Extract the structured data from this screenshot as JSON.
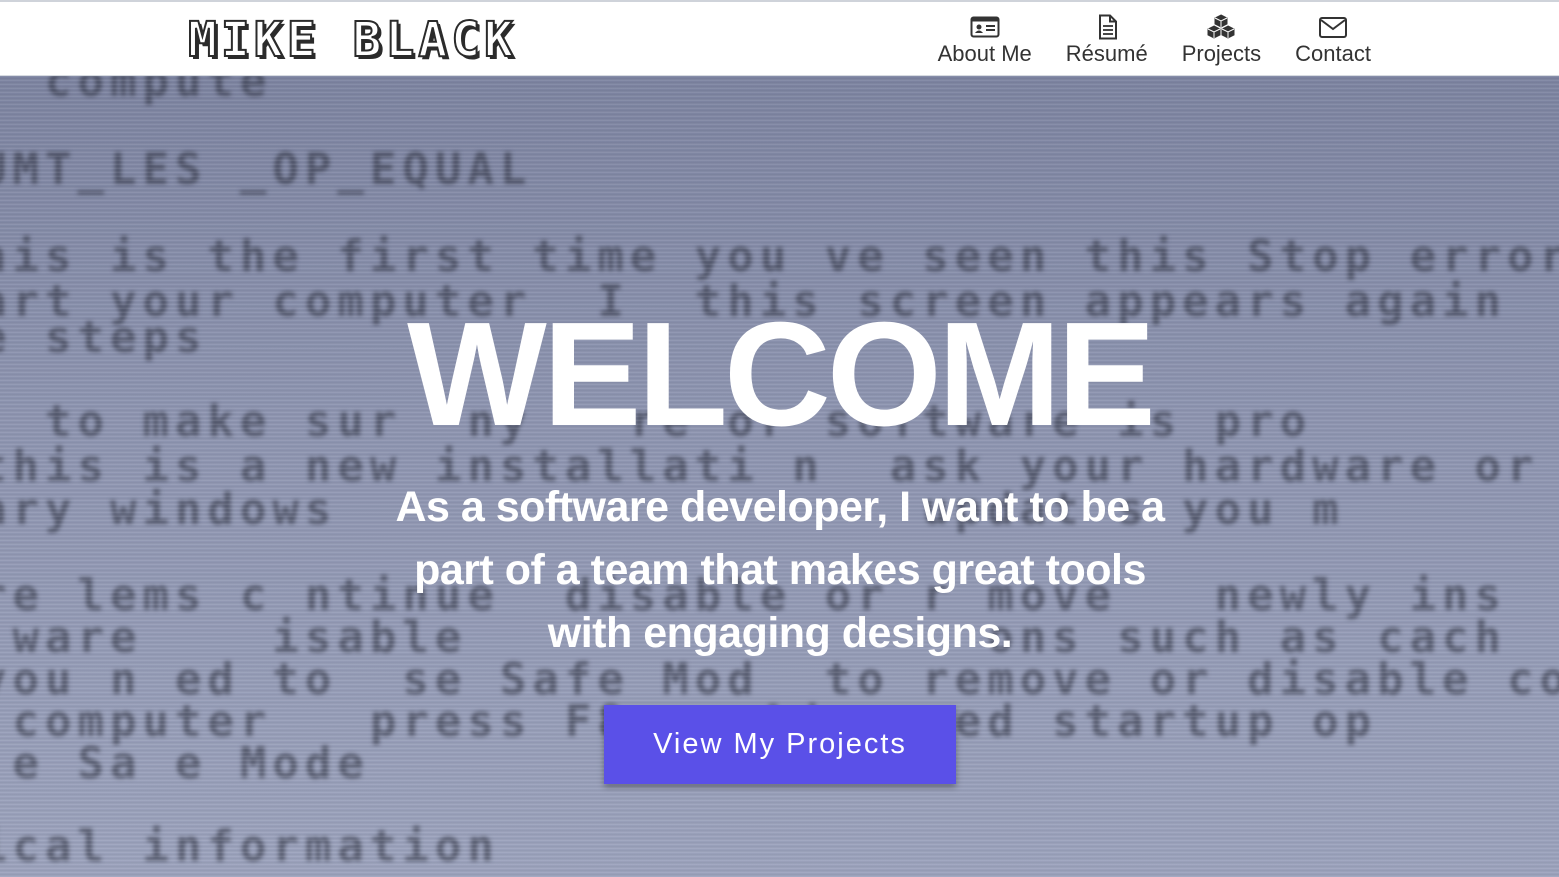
{
  "header": {
    "logo_text": "MIKE BLACK",
    "nav": [
      {
        "label": "About Me",
        "icon": "id-card-icon"
      },
      {
        "label": "Résumé",
        "icon": "document-icon"
      },
      {
        "label": "Projects",
        "icon": "cubes-icon"
      },
      {
        "label": "Contact",
        "icon": "envelope-icon"
      }
    ]
  },
  "hero": {
    "background_lines": [
      "  compute",
      "UMT_LES _OP_EQUAL",
      "",
      "his is the first time you ve seen this Stop error",
      "art your computer  I  this screen appears again",
      "e steps",
      "",
      "  to make sur  ny   re or software is pro",
      "this is a new installati n  ask your hardware or s",
      "ary windows                  updat s you m",
      "",
      "re lems c ntinue  disable or r move   newly ins",
      " ware    isable                ons such as cach",
      "you n ed to  se Safe Mod  to remove or disable com",
      " computer   press F8    Advanced startup op",
      " e Sa e Mode",
      "",
      "ical information"
    ],
    "title": "WELCOME",
    "tagline_lines": [
      "As a software developer, I want to be a",
      "part of a team that makes great tools",
      "with engaging designs."
    ],
    "cta_label": "View My Projects"
  },
  "colors": {
    "accent": "#5a50e8",
    "hero_bg": "#8d94b0",
    "nav_text": "#333333"
  }
}
